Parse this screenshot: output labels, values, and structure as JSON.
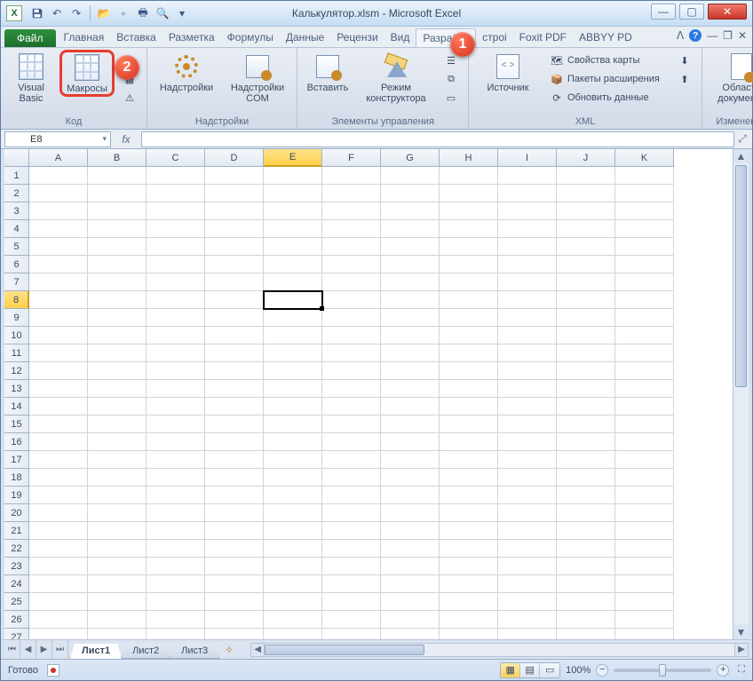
{
  "title": "Калькулятор.xlsm  -  Microsoft Excel",
  "tabs": {
    "file": "Файл",
    "items": [
      "Главная",
      "Вставка",
      "Разметка",
      "Формулы",
      "Данные",
      "Рецензи",
      "Вид",
      "Разработ",
      "строі",
      "Foxit PDF",
      "ABBYY PD"
    ],
    "active_index": 7
  },
  "callouts": {
    "one": "1",
    "two": "2"
  },
  "ribbon": {
    "code": {
      "vb": "Visual\nBasic",
      "macros": "Макросы",
      "label": "Код"
    },
    "addins": {
      "addins": "Надстройки",
      "com": "Надстройки COM",
      "label": "Надстройки"
    },
    "controls": {
      "insert": "Вставить",
      "design": "Режим конструктора",
      "label": "Элементы управления"
    },
    "xml": {
      "source": "Источник",
      "map_props": "Свойства карты",
      "expansion": "Пакеты расширения",
      "refresh": "Обновить данные",
      "label": "XML"
    },
    "modify": {
      "doc_area": "Область документа",
      "label": "Изменение"
    }
  },
  "formula_bar": {
    "name_box": "E8",
    "fx": "fx",
    "value": ""
  },
  "grid": {
    "columns": [
      "A",
      "B",
      "C",
      "D",
      "E",
      "F",
      "G",
      "H",
      "I",
      "J",
      "K"
    ],
    "rows": 28,
    "active": {
      "col": "E",
      "row": 8
    },
    "sel_col_index": 4,
    "sel_row": 8
  },
  "sheets": {
    "items": [
      "Лист1",
      "Лист2",
      "Лист3"
    ],
    "active_index": 0
  },
  "status": {
    "ready": "Готово",
    "zoom": "100%"
  }
}
